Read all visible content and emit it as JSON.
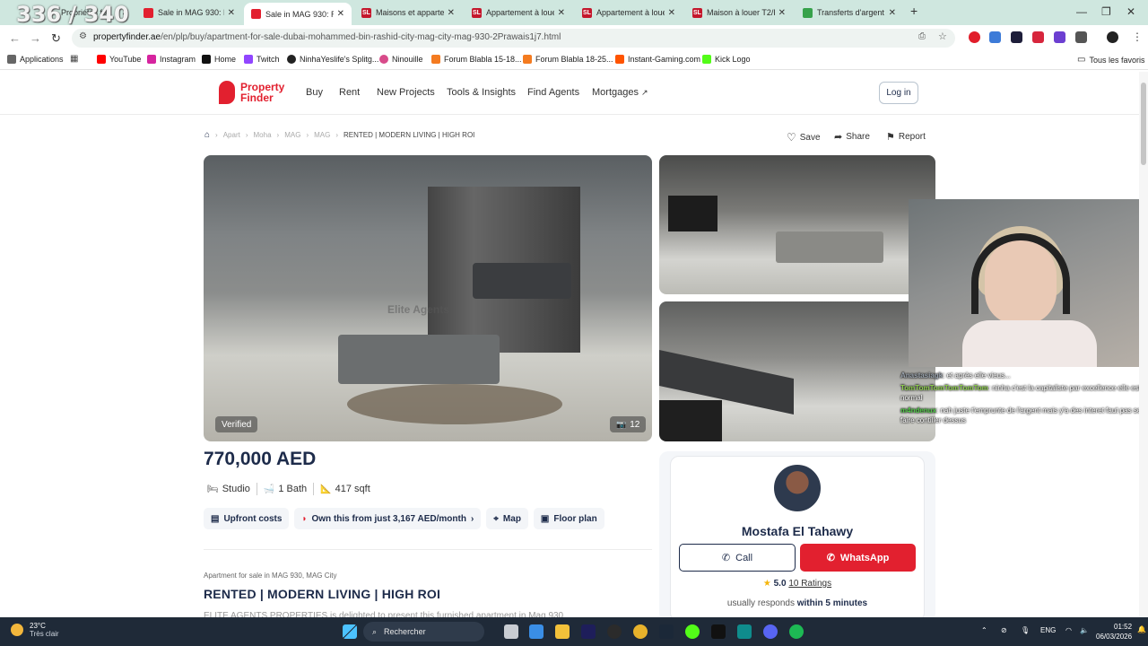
{
  "overlay": {
    "counter": "336 / 340"
  },
  "browser": {
    "tabs": [
      {
        "label": "Propriétés fo",
        "favicon_color": "#e2202f",
        "active": false
      },
      {
        "label": "Sale in MAG 930: Bur",
        "favicon_color": "#e2202f",
        "active": false
      },
      {
        "label": "Sale in MAG 930: REN",
        "favicon_color": "#e2202f",
        "active": true
      },
      {
        "label": "Maisons et appartem",
        "favicon_color": "#c4172c",
        "favicon_text": "SL",
        "active": false
      },
      {
        "label": "Appartement à louer",
        "favicon_color": "#c4172c",
        "favicon_text": "SL",
        "active": false
      },
      {
        "label": "Appartement à louer",
        "favicon_color": "#c4172c",
        "favicon_text": "SL",
        "active": false
      },
      {
        "label": "Maison à louer T2/F2",
        "favicon_color": "#c4172c",
        "favicon_text": "SL",
        "active": false
      },
      {
        "label": "Transferts d'argent in",
        "favicon_color": "#37a24b",
        "active": false
      }
    ],
    "url_domain": "propertyfinder.ae",
    "url_path": "/en/plp/buy/apartment-for-sale-dubai-mohammed-bin-rashid-city-mag-city-mag-930-2Prawais1j7.html",
    "bookmarks": [
      {
        "label": "Applications",
        "icon": "grid-icon",
        "color": "#666"
      },
      {
        "label": "YouTube",
        "icon": "youtube-icon",
        "color": "#ff0000"
      },
      {
        "label": "Instagram",
        "icon": "instagram-icon",
        "color": "#d6249f"
      },
      {
        "label": "Home",
        "icon": "x-icon",
        "color": "#111"
      },
      {
        "label": "Twitch",
        "icon": "twitch-icon",
        "color": "#9146ff"
      },
      {
        "label": "NinhaYeslife's Splitg...",
        "icon": "splitgate-icon",
        "color": "#222"
      },
      {
        "label": "Ninouille",
        "icon": "ninouille-icon",
        "color": "#d84b8a"
      },
      {
        "label": "Forum Blabla 15-18...",
        "icon": "jv-icon",
        "color": "#f47b20"
      },
      {
        "label": "Forum Blabla 18-25...",
        "icon": "jv-icon",
        "color": "#f47b20"
      },
      {
        "label": "Instant-Gaming.com",
        "icon": "instant-gaming-icon",
        "color": "#ff5400"
      },
      {
        "label": "Kick Logo",
        "icon": "kick-icon",
        "color": "#53fc18"
      }
    ],
    "all_bookmarks": "Tous les favoris"
  },
  "site": {
    "logo_line1": "Property",
    "logo_line2": "Finder",
    "nav": [
      "Buy",
      "Rent",
      "New Projects",
      "Tools & Insights",
      "Find Agents",
      "Mortgages"
    ],
    "login": "Log in",
    "brand_color": "#e2202f"
  },
  "breadcrumb": [
    "Apart",
    "Moha",
    "MAG",
    "MAG",
    "RENTED | MODERN LIVING | HIGH ROI"
  ],
  "actions": {
    "save": "Save",
    "share": "Share",
    "report": "Report"
  },
  "gallery": {
    "verified": "Verified",
    "photo_count": "12",
    "watermark": "Elite Agents"
  },
  "listing": {
    "price": "770,000 AED",
    "type": "Studio",
    "baths": "1 Bath",
    "area": "417 sqft",
    "chips": {
      "upfront": "Upfront costs",
      "own": "Own this from just 3,167 AED/month",
      "map": "Map",
      "floorplan": "Floor plan"
    },
    "subtitle": "Apartment for sale in MAG 930, MAG City",
    "title": "RENTED | MODERN LIVING | HIGH ROI",
    "description": "ELITE AGENTS PROPERTIES is delighted to present this furnished apartment in Mag 930"
  },
  "agent": {
    "name": "Mostafa El Tahawy",
    "call": "Call",
    "whatsapp": "WhatsApp",
    "rating": "5.0",
    "ratings_count": "10 Ratings",
    "responds_prefix": "usually responds",
    "responds_time": "within 5 minutes"
  },
  "chat": [
    {
      "user": "Anastasiagk",
      "message": "et après elle vieus..."
    },
    {
      "user": "TomTomTomTomTomTom",
      "message": "ninha c'est la capitaliste par excellence elle est normal"
    },
    {
      "user": "m4ndenux",
      "message": "nah juste t'emprunte de l'argent mais y'a des interet faut pas se faire contiller dessus"
    }
  ],
  "taskbar": {
    "temperature": "23°C",
    "weather": "Très clair",
    "search": "Rechercher",
    "lang": "ENG",
    "time": "01:52",
    "date": "06/03/2026"
  }
}
